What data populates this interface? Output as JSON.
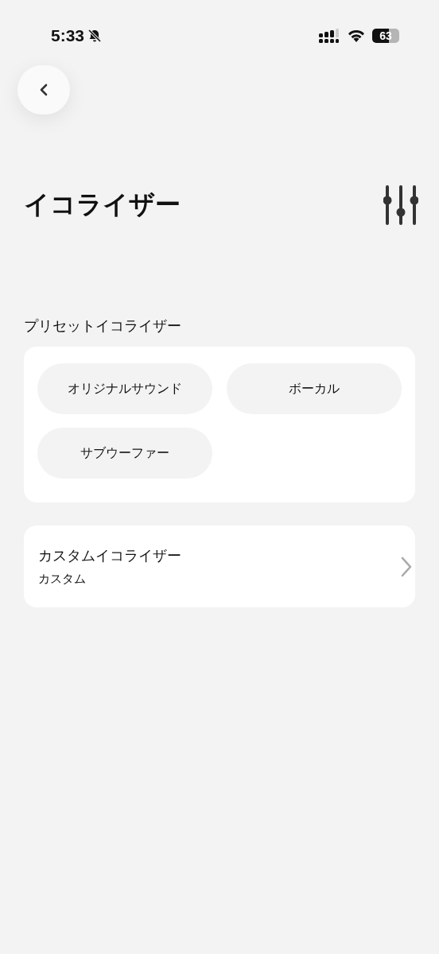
{
  "status_bar": {
    "time": "5:33",
    "battery": "63"
  },
  "header": {
    "title": "イコライザー"
  },
  "presets": {
    "label": "プリセットイコライザー",
    "items": [
      {
        "label": "オリジナルサウンド",
        "selected": false
      },
      {
        "label": "ボーカル",
        "selected": false
      },
      {
        "label": "サブウーファー",
        "selected": false
      }
    ]
  },
  "custom": {
    "title": "カスタムイコライザー",
    "subtitle": "カスタム"
  }
}
